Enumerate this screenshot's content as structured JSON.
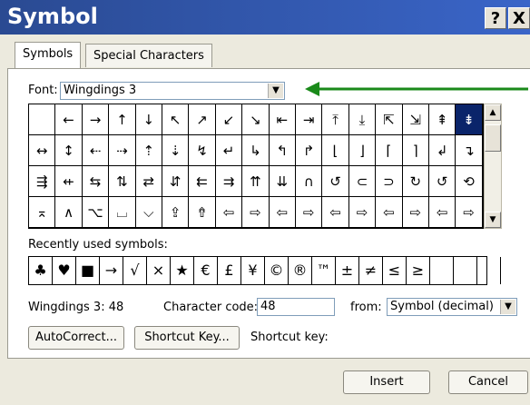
{
  "window": {
    "title": "Symbol",
    "help_label": "?",
    "close_label": "X"
  },
  "tabs": [
    {
      "label": "Symbols",
      "active": true
    },
    {
      "label": "Special Characters",
      "active": false
    }
  ],
  "font": {
    "label": "Font:",
    "value": "Wingdings 3"
  },
  "grid": {
    "rows": [
      [
        "",
        "←",
        "→",
        "↑",
        "↓",
        "↖",
        "↗",
        "↙",
        "↘",
        "⇤",
        "⇥",
        "⤒",
        "⤓",
        "⇱",
        "⇲",
        "⇞",
        "⇟"
      ],
      [
        "↔",
        "↕",
        "⇠",
        "⇢",
        "⇡",
        "⇣",
        "↯",
        "↵",
        "↳",
        "↰",
        "↱",
        "⌊",
        "⌋",
        "⌈",
        "⌉",
        "↲",
        "↴"
      ],
      [
        "⇶",
        "⇷",
        "⇆",
        "⇅",
        "⇄",
        "⇵",
        "⇇",
        "⇉",
        "⇈",
        "⇊",
        "∩",
        "↺",
        "⊂",
        "⊃",
        "↻",
        "↺",
        "⟲"
      ],
      [
        "⌅",
        "∧",
        "⌥",
        "⌴",
        "⌵",
        "⇪",
        "⇮",
        "⇦",
        "⇨",
        "⇦",
        "⇨",
        "⇦",
        "⇨",
        "⇦",
        "⇨",
        "⇦",
        "⇨"
      ]
    ],
    "selected_row": 0,
    "selected_col": 16
  },
  "recent": {
    "label": "Recently used symbols:",
    "symbols": [
      "♣",
      "♥",
      "■",
      "→",
      "√",
      "×",
      "★",
      "€",
      "£",
      "¥",
      "©",
      "®",
      "™",
      "±",
      "≠",
      "≤",
      "≥",
      "",
      "",
      ""
    ]
  },
  "info": {
    "name": "Wingdings 3: 48",
    "code_label": "Character code:",
    "code_value": "48",
    "from_label": "from:",
    "from_value": "Symbol (decimal)"
  },
  "buttons": {
    "autocorrect": "AutoCorrect...",
    "shortcut_key": "Shortcut Key...",
    "shortcut_label": "Shortcut key:",
    "insert": "Insert",
    "cancel": "Cancel"
  },
  "colors": {
    "annotation_arrow": "#1a8a1a",
    "title_bar": "#2a4a92",
    "selection": "#0a246a"
  },
  "icons": {
    "scroll_up": "triangle-up-icon",
    "scroll_down": "triangle-down-icon",
    "dropdown": "triangle-down-icon"
  }
}
